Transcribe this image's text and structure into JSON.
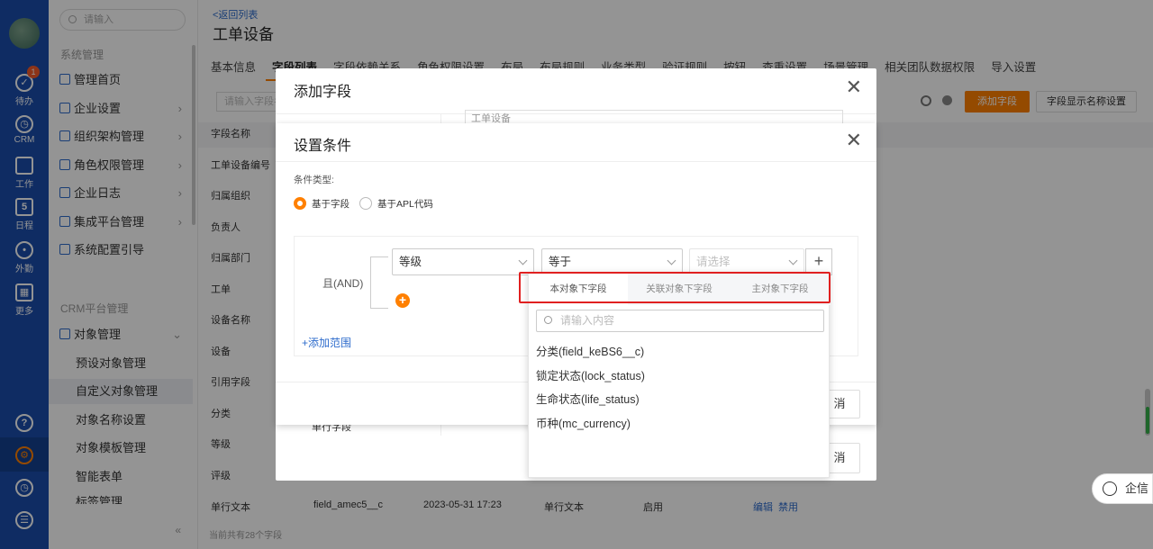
{
  "rail": {
    "todo_label": "待办",
    "todo_badge": "1",
    "crm_label": "CRM",
    "work_label": "工作",
    "schedule_label": "日程",
    "schedule_num": "5",
    "field_label": "外勤",
    "more_label": "更多"
  },
  "nav": {
    "search_placeholder": "请输入",
    "section_system": "系统管理",
    "items": [
      "管理首页",
      "企业设置",
      "组织架构管理",
      "角色权限管理",
      "企业日志",
      "集成平台管理",
      "系统配置引导"
    ],
    "section_crm": "CRM平台管理",
    "object_mgmt": "对象管理",
    "sub_items": [
      "预设对象管理",
      "自定义对象管理",
      "对象名称设置",
      "对象模板管理",
      "智能表单",
      "标签管理"
    ],
    "collapse": "«"
  },
  "main": {
    "back": "<返回列表",
    "title": "工单设备",
    "tabs": [
      "基本信息",
      "字段列表",
      "字段依赖关系",
      "角色权限设置",
      "布局",
      "布局规则",
      "业务类型",
      "验证规则",
      "按钮",
      "查重设置",
      "场景管理",
      "相关团队数据权限",
      "导入设置"
    ],
    "search_placeholder": "请输入字段名",
    "add_field_btn": "添加字段",
    "display_name_btn": "字段显示名称设置",
    "rows": [
      "字段名称",
      "工单设备编号",
      "归属组织",
      "负责人",
      "归属部门",
      "工单",
      "设备名称",
      "设备",
      "引用字段",
      "分类",
      "等级",
      "评级"
    ],
    "last_row": {
      "name": "单行文本",
      "api": "field_amec5__c",
      "time": "2023-05-31 17:23",
      "type": "单行文本",
      "status": "启用",
      "edit": "编辑",
      "disable": "禁用"
    },
    "count": "当前共有28个字段"
  },
  "qixin": "企信",
  "modal_add": {
    "title": "添加字段",
    "close": "✕",
    "dummy": "工单设备",
    "row_label": "单行字段",
    "cancel_tail": "消"
  },
  "modal_cond": {
    "title": "设置条件",
    "close": "✕",
    "type_label": "条件类型:",
    "radio_field": "基于字段",
    "radio_apl": "基于APL代码",
    "and_label": "且(AND)",
    "field_select": "等级",
    "operator_select": "等于",
    "value_placeholder": "请选择",
    "plus": "+",
    "add_circle": "+",
    "add_range": "+添加范围",
    "cancel_tail": "消"
  },
  "dropdown": {
    "tabs": [
      "本对象下字段",
      "关联对象下字段",
      "主对象下字段"
    ],
    "search_placeholder": "请输入内容",
    "items": [
      "分类(field_keBS6__c)",
      "锁定状态(lock_status)",
      "生命状态(life_status)",
      "币种(mc_currency)"
    ]
  },
  "colors": {
    "rail": "#1a4dab",
    "accent": "#ff8000",
    "link": "#2e6ccc",
    "highlight": "#e02020"
  }
}
